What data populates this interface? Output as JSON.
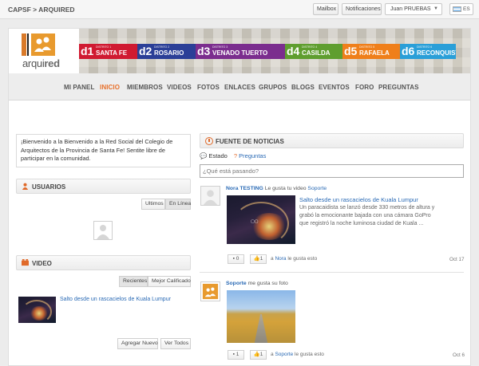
{
  "topbar": {
    "breadcrumb": "CAPSF > ARQUIRED",
    "mailbox": "Mailbox",
    "notifications": "Notificaciones",
    "user": "Juan PRUEBAS",
    "lang": "ES"
  },
  "logo": {
    "text_a": "arqui",
    "text_b": "red"
  },
  "districts": [
    {
      "num": "d1",
      "label": "DISTRITO 1",
      "city": "SANTA FE",
      "color": "#d01a31"
    },
    {
      "num": "d2",
      "label": "DISTRITO 2",
      "city": "ROSARIO",
      "color": "#2b3f97"
    },
    {
      "num": "d3",
      "label": "DISTRITO 3",
      "city": "VENADO TUERTO",
      "color": "#7b2d8e"
    },
    {
      "num": "d4",
      "label": "DISTRITO 4",
      "city": "CASILDA",
      "color": "#5f9e2f"
    },
    {
      "num": "d5",
      "label": "DISTRITO 5",
      "city": "RAFAELA",
      "color": "#ef7f1a"
    },
    {
      "num": "d6",
      "label": "DISTRITO 6",
      "city": "RECONQUISTA",
      "color": "#2a9fd8"
    }
  ],
  "nav": [
    "MI PANEL",
    "INICIO",
    "MIEMBROS",
    "VIDEOS",
    "FOTOS",
    "ENLACES",
    "GRUPOS",
    "BLOGS",
    "EVENTOS",
    "FORO",
    "PREGUNTAS"
  ],
  "nav_active": "INICIO",
  "welcome": "¡Bienvenido a la Bienvenido a la Red Social del Colegio de Arquitectos de la Provincia de Santa Fe! Sentite libre de participar en la comunidad.",
  "usuarios": {
    "title": "USUARIOS",
    "tab1": "Ultimos",
    "tab2": "En Línea"
  },
  "video": {
    "title": "VIDEO",
    "tab1": "Recientes",
    "tab2": "Mejor Calificado",
    "item_title": "Salto desde un rascacielos de Kuala Lumpur",
    "add": "Agregar Nuevo",
    "all": "Ver Todos"
  },
  "feed": {
    "title": "FUENTE DE NOTICIAS",
    "tab_estado": "Estado",
    "tab_preguntas": "Preguntas",
    "placeholder": "¿Qué está pasando?",
    "item1": {
      "user": "Nora TESTING",
      "action": "Le gusta tu video",
      "target": "Soporte",
      "title": "Salto desde un rascacielos de Kuala Lumpur",
      "desc": "Un paracaidista se lanzó desde 330 metros de altura y grabó la emocionante bajada con una cámara GoPro que registró la noche luminosa ciudad de Kuala ...",
      "comments": "0",
      "likes": "1",
      "liked_by_prefix": "a",
      "liked_by": "Nora",
      "liked_by_suffix": "le gusta esto",
      "date": "Oct 17"
    },
    "item2": {
      "user": "Soporte",
      "action": "me gusta su foto",
      "comments": "1",
      "likes": "1",
      "liked_by_prefix": "a",
      "liked_by": "Soporte",
      "liked_by_suffix": "le gusta esto",
      "date": "Oct 6"
    }
  },
  "colors": {
    "accent": "#e8702a",
    "link": "#2a6ab5"
  }
}
